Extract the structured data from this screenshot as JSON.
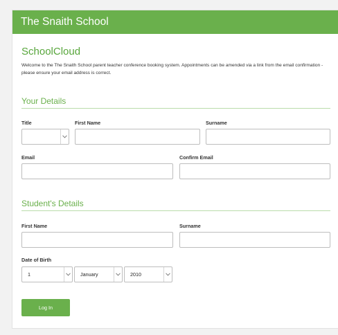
{
  "header": {
    "title": "The Snaith School"
  },
  "app": {
    "title": "SchoolCloud",
    "intro": "Welcome to the The Snaith School parent teacher conference booking system. Appointments can be amended via a link from the email confirmation - please ensure your email address is correct."
  },
  "your_details": {
    "heading": "Your Details",
    "title_label": "Title",
    "title_value": "",
    "first_name_label": "First Name",
    "first_name_value": "",
    "surname_label": "Surname",
    "surname_value": "",
    "email_label": "Email",
    "email_value": "",
    "confirm_email_label": "Confirm Email",
    "confirm_email_value": ""
  },
  "student_details": {
    "heading": "Student's Details",
    "first_name_label": "First Name",
    "first_name_value": "",
    "surname_label": "Surname",
    "surname_value": "",
    "dob_label": "Date of Birth",
    "dob_day": "1",
    "dob_month": "January",
    "dob_year": "2010"
  },
  "actions": {
    "login_label": "Log In"
  },
  "colors": {
    "brand_green": "#6ab04c",
    "title_green": "#58a63c",
    "rule_green": "#b9dcaa"
  },
  "icons": {
    "select_caret": "chevron-down-icon"
  }
}
